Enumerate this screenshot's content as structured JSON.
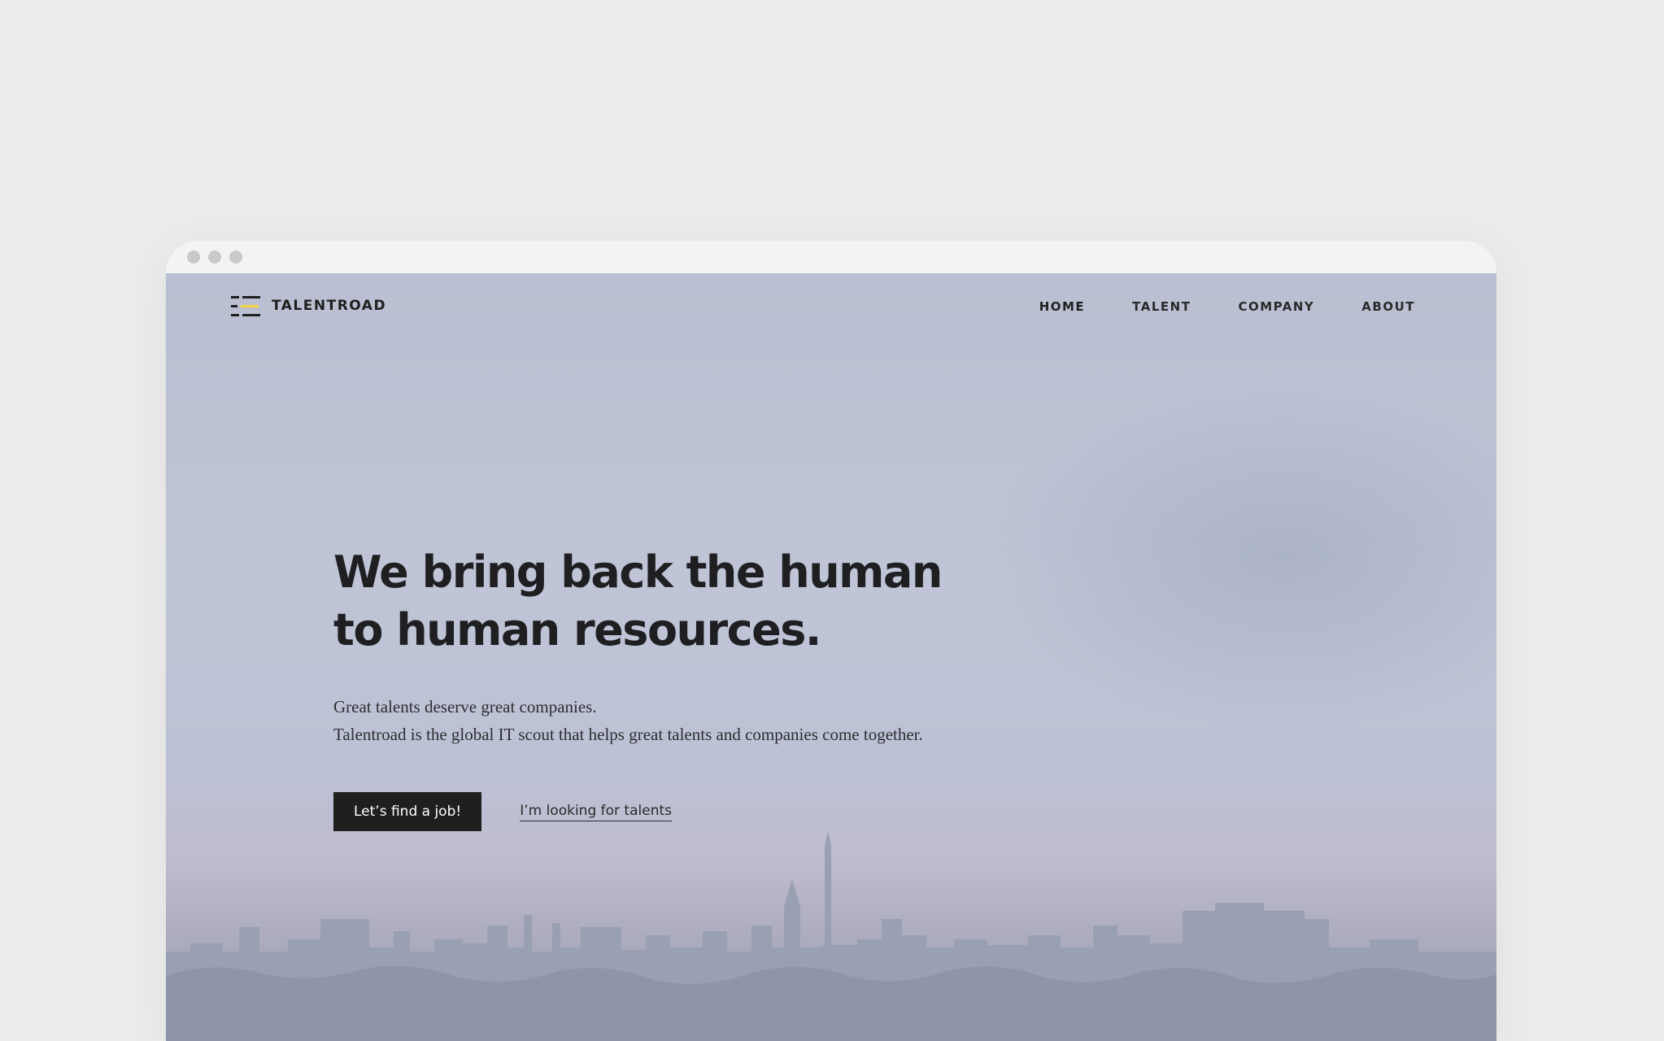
{
  "brand": {
    "name": "TALENTROAD",
    "accent_color": "#f5d43a"
  },
  "nav": {
    "items": [
      {
        "label": "HOME",
        "active": true
      },
      {
        "label": "TALENT",
        "active": false
      },
      {
        "label": "COMPANY",
        "active": false
      },
      {
        "label": "ABOUT",
        "active": false
      }
    ]
  },
  "hero": {
    "headline_line1": "We bring back the human",
    "headline_line2": "to human resources.",
    "sub_line1": "Great talents deserve great companies.",
    "sub_line2": "Talentroad is the global IT scout that helps great talents and companies come together.",
    "primary_cta": "Let’s find a job!",
    "secondary_cta": "I’m looking for talents"
  },
  "colors": {
    "text_dark": "#1f1f1f",
    "page_background": "#ececec"
  }
}
